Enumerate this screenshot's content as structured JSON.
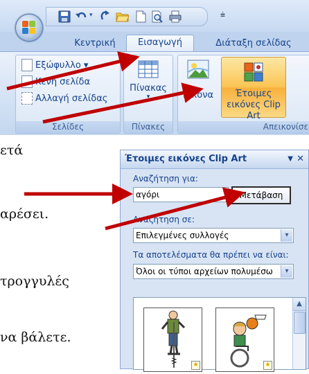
{
  "colors": {
    "ribbon_text": "#15428b",
    "arrow_red": "#c00000",
    "active_orange": "#fbc453"
  },
  "qat": {
    "icons": [
      "save-icon",
      "undo-icon",
      "redo-icon",
      "open-folder-icon",
      "new-document-icon",
      "print-preview-icon",
      "print-icon"
    ],
    "customize_glyph": "⩧"
  },
  "tabs": {
    "home": "Κεντρική",
    "insert": "Εισαγωγή",
    "page_layout": "Διάταξη σελίδας"
  },
  "ribbon": {
    "pages_group": {
      "cover_page": "Εξώφυλλο ▾",
      "blank_page": "Κενή σελίδα",
      "page_break": "Αλλαγή σελίδας",
      "label": "Σελίδες"
    },
    "tables_group": {
      "table": "Πίνακας",
      "label": "Πίνακες"
    },
    "illustrations_group": {
      "picture": "Εικόνα",
      "clip_art_line1": "Έτοιμες",
      "clip_art_line2": "εικόνες Clip Art",
      "label": "Απεικονίσε"
    }
  },
  "document": {
    "line1": "ετά",
    "line2": "αρέσει.",
    "line3": "τρογγυλές",
    "line4": "να βάλετε."
  },
  "task_pane": {
    "title": "Έτοιμες εικόνες Clip Art",
    "menu_glyph": "▼",
    "close_glyph": "✕",
    "search_label": "Αναζήτηση για:",
    "search_value": "αγόρι",
    "go_button": "Μετάβαση",
    "search_in_label": "Αναζήτηση σε:",
    "search_in_value": "Επιλεγμένες συλλογές",
    "results_label": "Τα αποτελέσματα θα πρέπει να είναι:",
    "results_value": "Όλοι οι τύποι αρχείων πολυμέσω",
    "dropdown_glyph": "▾",
    "scroll_up_glyph": "▲",
    "thumbnails": [
      "boy-on-pogo-stick-clipart",
      "boy-in-wheelchair-basketball-clipart"
    ]
  }
}
